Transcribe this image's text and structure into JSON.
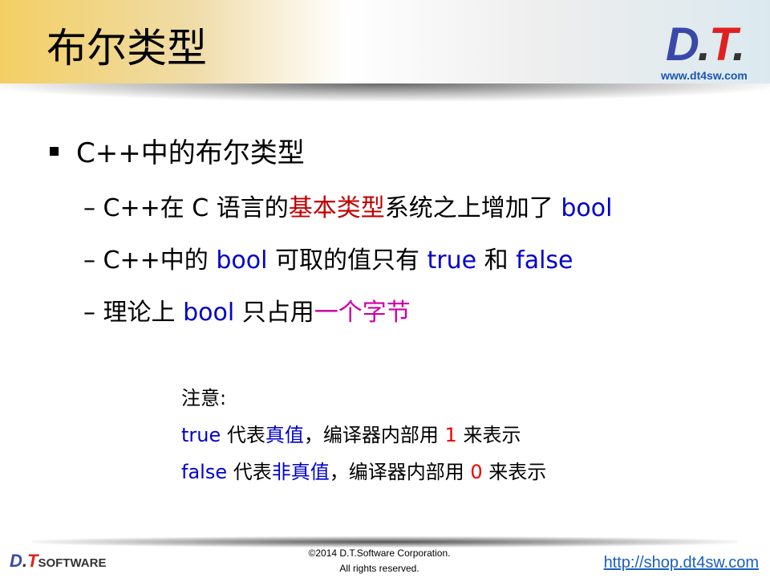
{
  "header": {
    "title": "布尔类型",
    "logo": "D.T.",
    "url": "www.dt4sw.com"
  },
  "bullet": "C++中的布尔类型",
  "sub1": {
    "a": "C++在 C 语言的",
    "b": "基本类型",
    "c": "系统之上增加了 ",
    "d": "bool"
  },
  "sub2": {
    "a": "C++中的 ",
    "b": "bool",
    "c": " 可取的值只有 ",
    "d": "true",
    "e": " 和 ",
    "f": "false"
  },
  "sub3": {
    "a": "理论上 ",
    "b": "bool",
    "c": " 只占用",
    "d": "一个字节"
  },
  "note": {
    "label": "注意:",
    "l1": {
      "a": "true",
      "b": " 代表",
      "c": "真值",
      "d": "，编译器内部用 ",
      "e": "1",
      "f": " 来表示"
    },
    "l2": {
      "a": "false",
      "b": " 代表",
      "c": "非真值",
      "d": "，编译器内部用 ",
      "e": "0",
      "f": " 来表示"
    }
  },
  "footer": {
    "logo": "D.T.",
    "logo_word": "SOFTWARE",
    "copyright": "©2014 D.T.Software Corporation.",
    "rights": "All rights reserved.",
    "shop": "http://shop.dt4sw.com"
  },
  "colors": {
    "keyword": "#0000cc",
    "emphasis": "#c00000",
    "magenta": "#cc00aa",
    "number": "#e00000"
  }
}
